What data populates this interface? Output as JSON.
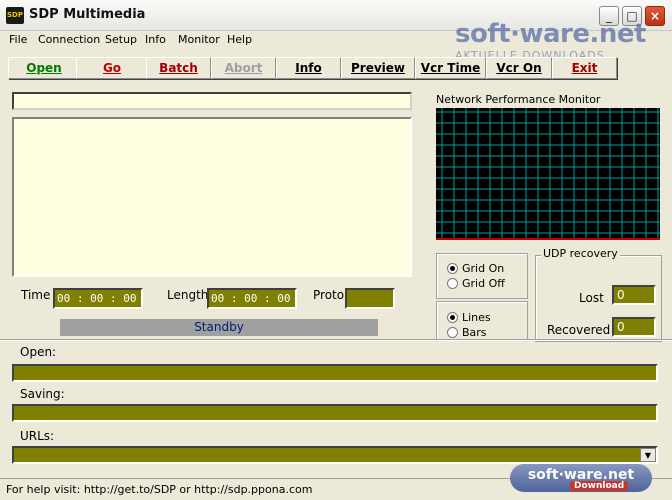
{
  "window": {
    "title": "SDP Multimedia",
    "icon_text": "SDP",
    "minimize_glyph": "_",
    "maximize_glyph": "□",
    "close_glyph": "×"
  },
  "watermark": {
    "top": "soft·ware.net",
    "top_sub": "AKTUELLE DOWNLOADS",
    "bottom": "soft·ware.net",
    "bottom_sub": "Download"
  },
  "menu": [
    "File",
    "Connection",
    "Setup",
    "Info",
    "Monitor",
    "Help"
  ],
  "toolbar": {
    "open": "Open",
    "go": "Go",
    "batch": "Batch",
    "abort": "Abort",
    "info": "Info",
    "preview": "Preview",
    "vcr_time": "Vcr Time",
    "vcr_on": "Vcr On",
    "exit": "Exit"
  },
  "playback": {
    "time_label": "Time",
    "time_value": "00 : 00 : 00",
    "length_label": "Length",
    "length_value": "00 : 00 : 00",
    "proto_label": "Proto",
    "proto_value": "",
    "status": "Standby"
  },
  "monitor": {
    "title": "Network Performance Monitor",
    "grid_color": "#00a0a0",
    "baseline_color": "#c00000"
  },
  "grid_options": {
    "grid_on": "Grid On",
    "grid_off": "Grid Off",
    "selected": "Grid On"
  },
  "plot_options": {
    "lines": "Lines",
    "bars": "Bars",
    "selected": "Lines"
  },
  "udp": {
    "title": "UDP recovery",
    "lost_label": "Lost",
    "lost_value": "0",
    "recovered_label": "Recovered",
    "recovered_value": "0"
  },
  "bottom": {
    "open_label": "Open:",
    "saving_label": "Saving:",
    "urls_label": "URLs:",
    "dropdown_glyph": "▼"
  },
  "status": {
    "text": "For help visit: http://get.to/SDP or http://sdp.ppona.com"
  }
}
